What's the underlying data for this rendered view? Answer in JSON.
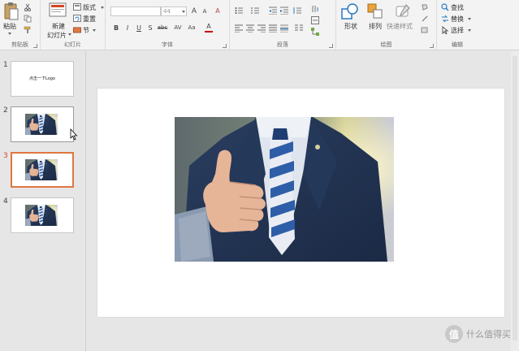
{
  "ribbon": {
    "clipboard": {
      "paste_label": "粘贴",
      "group_label": "剪贴板"
    },
    "slides": {
      "new_slide_label_1": "新建",
      "new_slide_label_2": "幻灯片",
      "layout_label": "版式",
      "reset_label": "重置",
      "section_label": "节",
      "group_label": "幻灯片"
    },
    "font": {
      "font_name": "",
      "font_size": "44",
      "bold": "B",
      "italic": "I",
      "underline": "U",
      "strike": "S",
      "shadow": "abc",
      "spacing": "AV",
      "case": "Aa",
      "grow": "A",
      "shrink": "A",
      "clear": "A",
      "group_label": "字体"
    },
    "paragraph": {
      "group_label": "段落"
    },
    "drawing": {
      "shapes_label": "形状",
      "arrange_label": "排列",
      "quick_styles_label": "快速样式",
      "group_label": "绘图"
    },
    "editing": {
      "find_label": "查找",
      "replace_label": "替换",
      "select_label": "选择",
      "group_label": "编辑"
    }
  },
  "thumbnails": [
    {
      "number": "1",
      "title": "点击一下Logo",
      "type": "title"
    },
    {
      "number": "2",
      "type": "photo"
    },
    {
      "number": "3",
      "type": "photo"
    },
    {
      "number": "4",
      "type": "photo"
    }
  ],
  "watermark": {
    "icon_char": "值",
    "text": "什么值得买"
  },
  "colors": {
    "accent": "#d24726",
    "ribbon_bg": "#f3f3f3",
    "selected_border": "#e0773f"
  }
}
